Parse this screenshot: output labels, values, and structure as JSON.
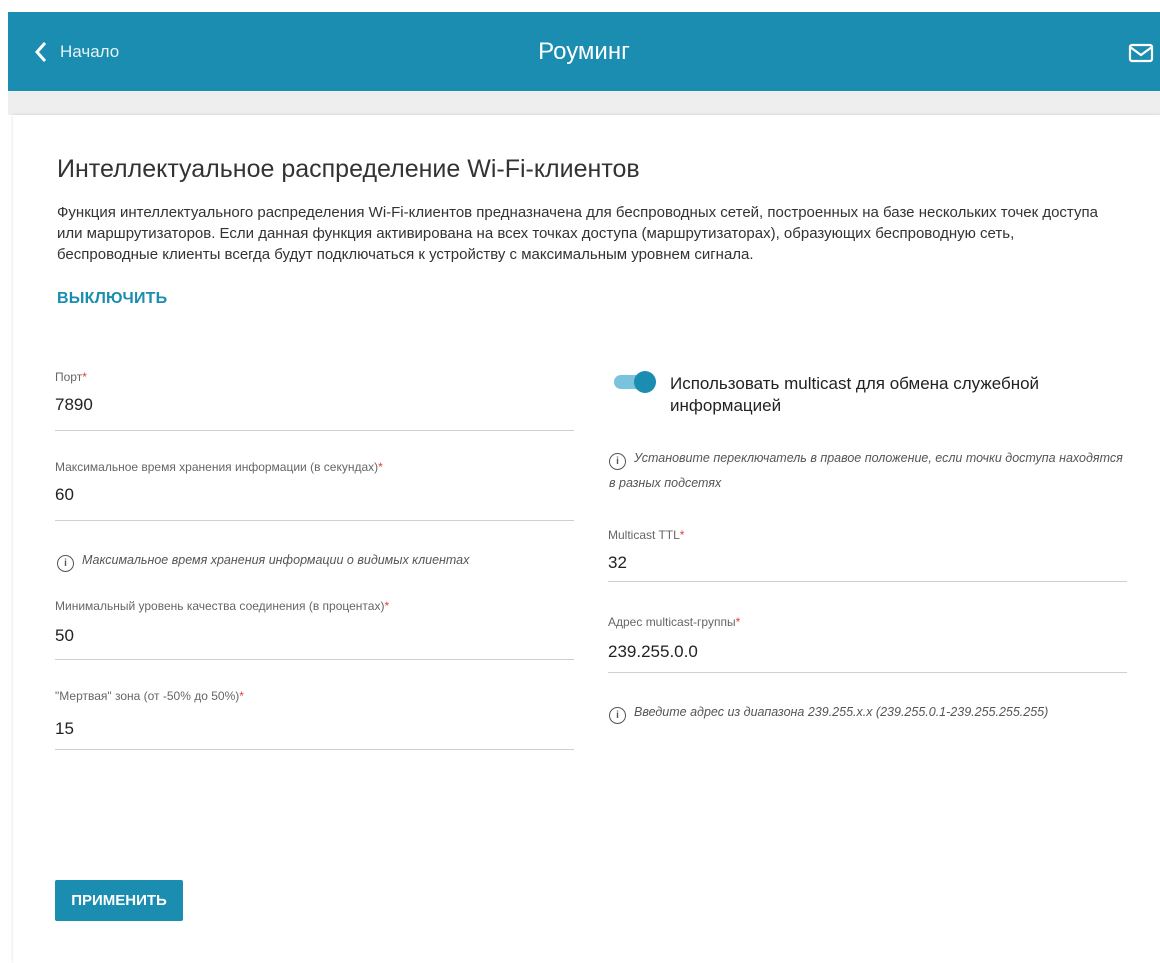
{
  "header": {
    "back_label": "Начало",
    "title": "Роуминг",
    "mail_icon": "mail-icon"
  },
  "section": {
    "title": "Интеллектуальное распределение Wi-Fi-клиентов",
    "description": "Функция интеллектуального распределения Wi-Fi-клиентов предназначена для беспроводных сетей, построенных на базе нескольких точек доступа или маршрутизаторов. Если данная функция активирована на всех точках доступа (маршрутизаторах), образующих беспроводную сеть, беспроводные клиенты всегда будут подключаться к устройству с максимальным уровнем сигнала.",
    "toggle_link": "ВЫКЛЮЧИТЬ"
  },
  "left": {
    "port": {
      "label": "Порт",
      "value": "7890"
    },
    "max_time": {
      "label": "Максимальное время хранения информации (в секундах)",
      "value": "60",
      "hint": "Максимальное время хранения информации о видимых клиентах"
    },
    "min_quality": {
      "label": "Минимальный уровень качества соединения (в процентах)",
      "value": "50"
    },
    "dead_zone": {
      "label": "\"Мертвая\" зона (от -50% до 50%)",
      "value": "15"
    }
  },
  "right": {
    "multicast_switch": {
      "label": "Использовать multicast для обмена служебной информацией",
      "on": true
    },
    "switch_hint": "Установите переключатель в правое положение, если точки доступа находятся в разных подсетях",
    "ttl": {
      "label": "Multicast TTL",
      "value": "32"
    },
    "group": {
      "label": "Адрес multicast-группы",
      "value": "239.255.0.0",
      "hint": "Введите адрес из диапазона 239.255.x.x (239.255.0.1-239.255.255.255)"
    }
  },
  "required_mark": "*",
  "hint_icon_glyph": "i",
  "apply_label": "ПРИМЕНИТЬ",
  "colors": {
    "accent": "#1a8db0",
    "required": "#e23b3b"
  }
}
